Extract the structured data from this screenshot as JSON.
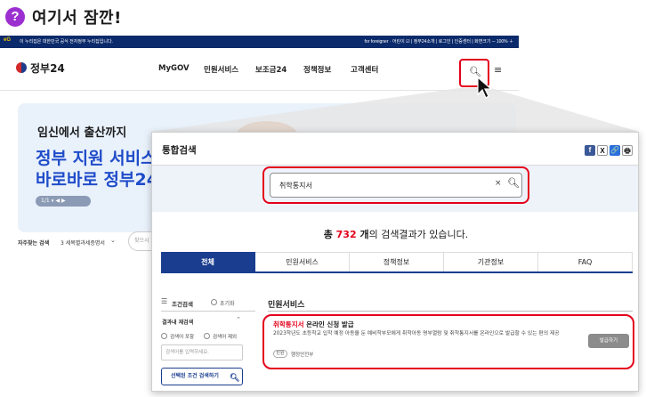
{
  "heading": {
    "icon": "?",
    "text": "여기서 잠깐!"
  },
  "site": {
    "topbar_logo": "eG",
    "topbar_left": "이 누리집은 대한민국 공식 전자정부 누리집입니다.",
    "topbar_right": "for foreigner  ·  어린이 ☑  |  정부24소개  |  로그인  |  인증센터  |  화면크기 ─ 100% ＋",
    "logo": "정부24",
    "menu": [
      "MyGOV",
      "민원서비스",
      "보조금24",
      "정책정보",
      "고객센터"
    ],
    "hero_line1": "임신에서 출산까지",
    "hero_line2": "정부 지원 서비스\n바로바로 정부24",
    "hero_pager": "1/1  ⏸  ◀  ▶",
    "frequent_label": "자주찾는 검색",
    "frequent_value": "3 세목별과세증명서",
    "frequent_placeholder": "찾으시"
  },
  "panel": {
    "title": "통합검색",
    "share_icons": [
      "f",
      "X",
      "🔗",
      "🖶"
    ],
    "search_value": "취학통지서",
    "clear": "×",
    "result_prefix": "총 ",
    "result_count": "732",
    "result_mid": " 개",
    "result_suffix": "의 검색결과가 있습니다.",
    "tabs": [
      "전체",
      "민원서비스",
      "정책정보",
      "기관정보",
      "FAQ"
    ],
    "filter": {
      "label": "조건검색",
      "reset": "초기화",
      "within_label": "결과내 재검색",
      "radio1": "검색어 포함",
      "radio2": "검색어 제외",
      "input_placeholder": "검색어를 입력하세요.",
      "button": "선택된 조건 검색하기"
    },
    "section_title": "민원서비스",
    "result": {
      "title_highlight": "취학통지서",
      "title_rest": " 온라인 신청 발급",
      "desc": "2023학년도 초등학교 입학 예정 아동을 둔 예비학부모에게 취학아동 명부열람 및 취학통지서를 온라인으로 발급할 수 있는 편의 제공",
      "badge": "민원",
      "org": "행정안전부",
      "button": "발급하기"
    }
  },
  "colors": {
    "accent_red": "#e4001b",
    "navy": "#1a3d8f",
    "purple": "#9b2fd0"
  }
}
